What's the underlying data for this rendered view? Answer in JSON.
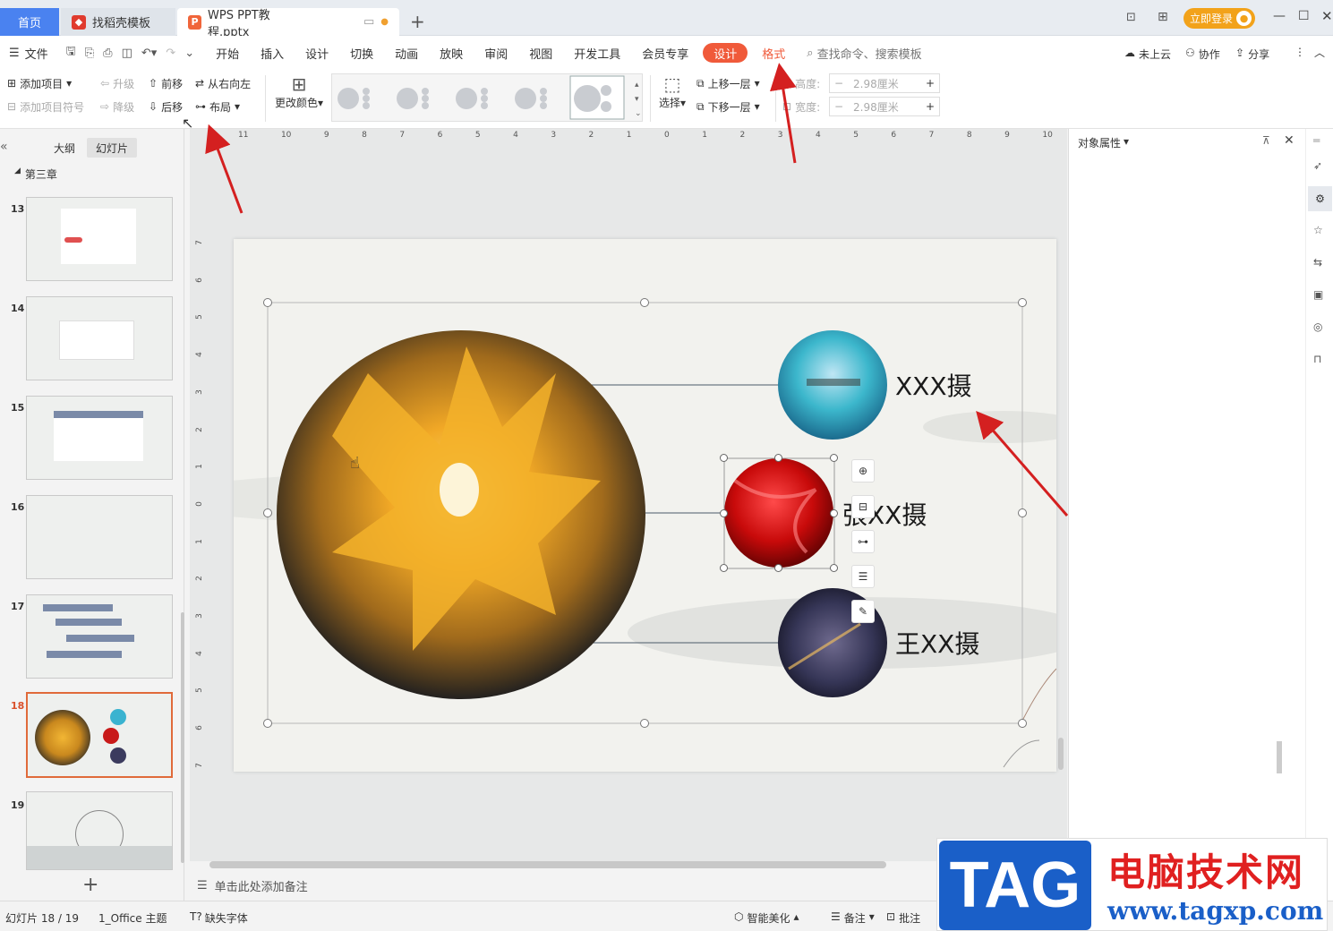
{
  "tabs": {
    "home": "首页",
    "template": "找稻壳模板",
    "doc": "WPS PPT教程.pptx",
    "login": "立即登录"
  },
  "menu": {
    "file": "文件",
    "items": [
      "开始",
      "插入",
      "设计",
      "切换",
      "动画",
      "放映",
      "审阅",
      "视图",
      "开发工具",
      "会员专享"
    ],
    "active": "设计",
    "format": "格式",
    "search": "查找命令、搜索模板",
    "cloud": "未上云",
    "collab": "协作",
    "share": "分享"
  },
  "ribbon": {
    "add_item": "添加项目",
    "add_bullet": "添加项目符号",
    "promote": "升级",
    "demote": "降级",
    "forward": "前移",
    "backward": "后移",
    "rtl": "从右向左",
    "layout": "布局",
    "change_color": "更改颜色",
    "select": "选择",
    "bring_forward": "上移一层",
    "send_backward": "下移一层",
    "height_label": "高度:",
    "width_label": "宽度:",
    "height_value": "2.98厘米",
    "width_value": "2.98厘米"
  },
  "panel": {
    "outline": "大纲",
    "slides": "幻灯片",
    "chapter": "第三章",
    "slide_numbers": [
      "13",
      "14",
      "15",
      "16",
      "17",
      "18",
      "19"
    ],
    "current": "18"
  },
  "ruler": {
    "h": [
      "11",
      "10",
      "9",
      "8",
      "7",
      "6",
      "5",
      "4",
      "3",
      "2",
      "1",
      "0",
      "1",
      "2",
      "3",
      "4",
      "5",
      "6",
      "7",
      "8",
      "9",
      "10"
    ],
    "v": [
      "7",
      "6",
      "5",
      "4",
      "3",
      "2",
      "1",
      "0",
      "1",
      "2",
      "3",
      "4",
      "5",
      "6",
      "7"
    ]
  },
  "slide": {
    "label1": "XXX摄",
    "label2": "張XX摄",
    "label3": "王XX摄"
  },
  "notes": "单击此处添加备注",
  "right_panel": {
    "title": "对象属性"
  },
  "status": {
    "slide": "幻灯片 18 / 19",
    "theme": "1_Office 主题",
    "missing_font": "缺失字体",
    "beautify": "智能美化",
    "notes": "备注",
    "comments": "批注"
  },
  "watermark": {
    "tag": "TAG",
    "site": "电脑技术网",
    "url": "www.tagxp.com"
  },
  "colors": {
    "accent": "#4a82f0",
    "active": "#f05a3a",
    "arrow": "#d42020"
  }
}
